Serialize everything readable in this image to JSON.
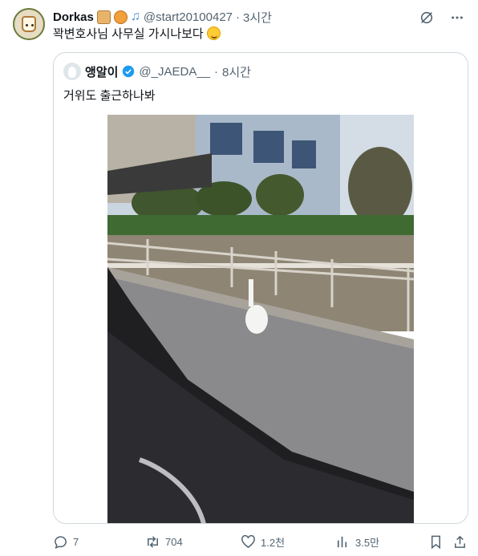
{
  "author": {
    "name": "Dorkas",
    "handle": "@start20100427",
    "separator": "·",
    "time": "3시간",
    "emoji_names": [
      "bread-emoji",
      "tiger-emoji",
      "music-note-emoji"
    ]
  },
  "tweet_text": "꽉변호사님 사무실 가시나보다",
  "quoted": {
    "name": "앵알이",
    "handle": "@_JAEDA__",
    "separator": "·",
    "time": "8시간",
    "verified": true,
    "text": "거위도 출근하나봐"
  },
  "actions": {
    "replies": "7",
    "retweets": "704",
    "likes": "1.2천",
    "views": "3.5만"
  },
  "colors": {
    "text": "#0f1419",
    "secondary": "#536471",
    "border": "#cfd9de",
    "verified": "#1d9bf0"
  }
}
